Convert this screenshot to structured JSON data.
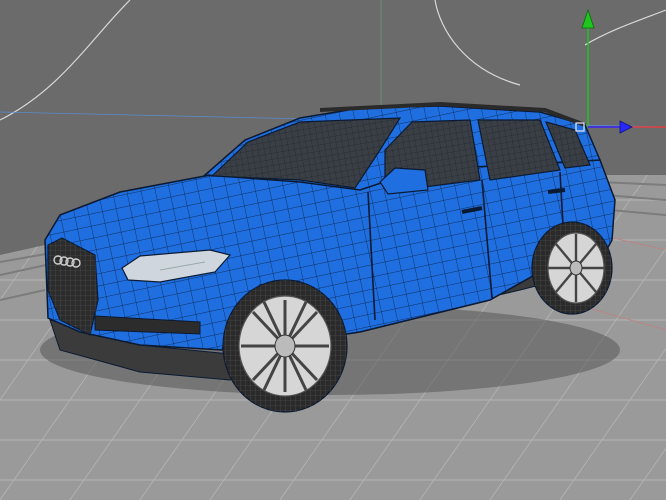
{
  "viewport": {
    "label": "",
    "background_color": "#6b6b6b",
    "floor_color": "#9a9a9a",
    "floor_tile_line_color": "#b4b4b4",
    "mesh_color": "#1f6fe0",
    "mesh_dark_color": "#1554b3",
    "wire_color": "#0b1a33",
    "glass_color": "#3a3f46",
    "tire_color": "#2a2a2a",
    "rim_color": "#d6d6d6",
    "trim_color": "#3b3b3b"
  },
  "gizmo": {
    "y_axis_color": "#1ec61e",
    "x_axis_color": "#e04040",
    "z_axis_color": "#2828ff",
    "pivot_icon": "pivot-square-icon",
    "y_icon": "y-arrow-icon",
    "z_icon": "z-arrow-icon"
  },
  "model": {
    "object": "suv-car-wireframe",
    "wheel_icon": "wheel-rim-icon"
  }
}
